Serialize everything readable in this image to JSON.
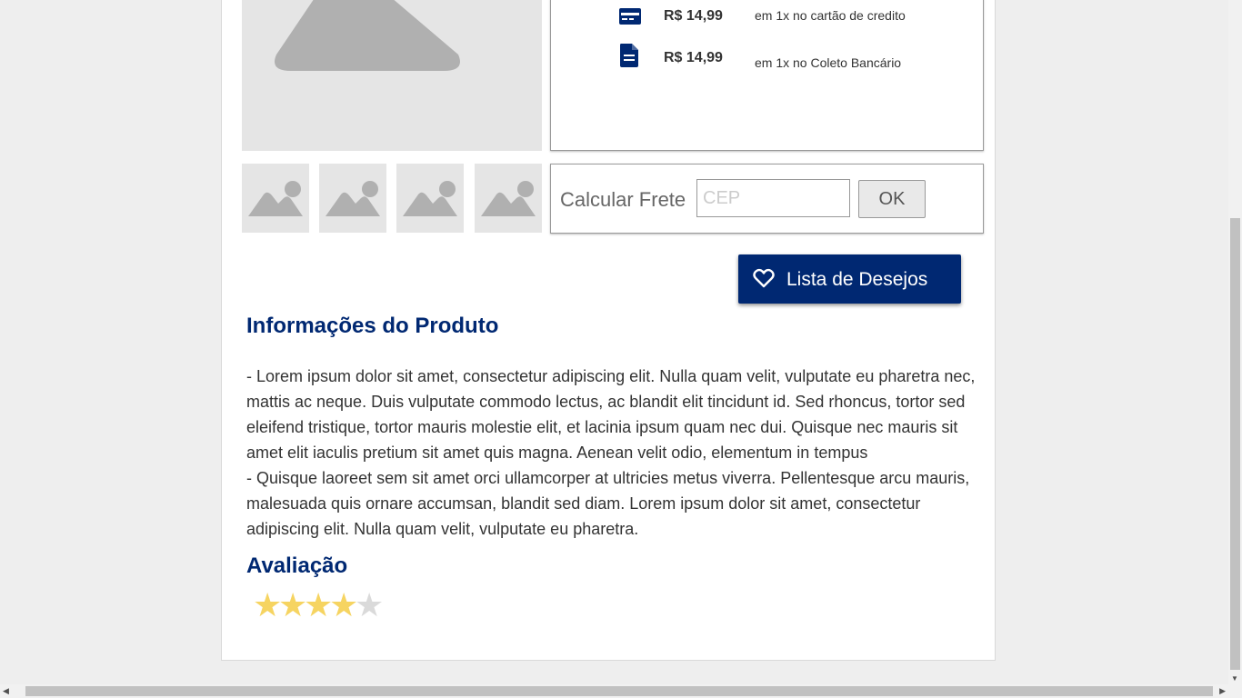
{
  "payment_options": [
    {
      "icon": "credit-card-icon",
      "amount": "R$ 14,99",
      "description": "em 1x no cartão de credito"
    },
    {
      "icon": "document-icon",
      "amount": "R$ 14,99",
      "description": "em 1x no Coleto Bancário"
    }
  ],
  "shipping": {
    "label": "Calcular Frete",
    "cep_placeholder": "CEP",
    "cep_value": "",
    "ok_label": "OK"
  },
  "wishlist": {
    "label": "Lista de Desejos",
    "icon": "heart-icon"
  },
  "product_info": {
    "title": "Informações do Produto",
    "paragraphs": [
      "-  Lorem ipsum dolor sit amet, consectetur adipiscing elit. Nulla quam velit, vulputate eu pharetra nec, mattis ac neque. Duis vulputate commodo lectus, ac blandit elit tincidunt id. Sed rhoncus, tortor sed eleifend tristique, tortor mauris molestie elit, et lacinia ipsum quam nec dui. Quisque nec mauris sit amet elit iaculis pretium sit amet quis magna. Aenean velit odio, elementum in tempus",
      "-  Quisque laoreet sem sit amet orci ullamcorper at ultricies metus viverra. Pellentesque arcu mauris, malesuada quis ornare accumsan, blandit sed diam. Lorem ipsum dolor sit amet, consectetur adipiscing elit. Nulla quam velit, vulputate eu pharetra."
    ]
  },
  "rating": {
    "title": "Avaliação",
    "value": 4,
    "max": 5
  },
  "colors": {
    "brand": "#002872",
    "star_on": "#f6d461",
    "star_off": "#dadada",
    "placeholder_bg": "#e5e5e5",
    "placeholder_fg": "#b0b0b0"
  },
  "thumbnails_count": 4
}
